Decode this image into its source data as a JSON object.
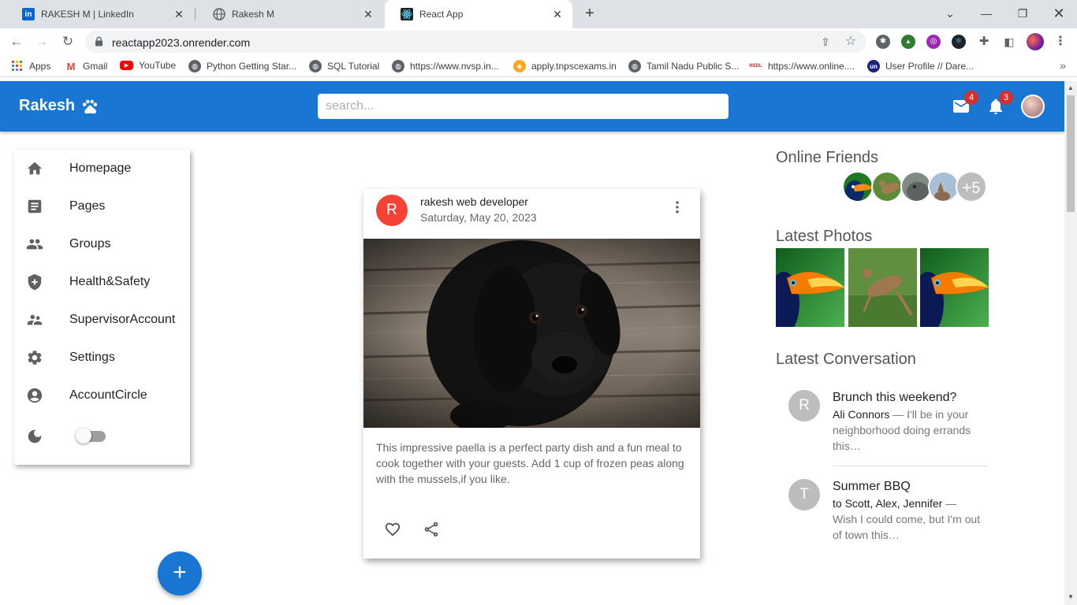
{
  "browser": {
    "tabs": [
      {
        "title": "RAKESH M | LinkedIn",
        "icon": "linkedin-icon",
        "color": "#0a66c2"
      },
      {
        "title": "Rakesh M",
        "icon": "globe-icon",
        "color": "#5f6368"
      },
      {
        "title": "React App",
        "icon": "react-icon",
        "color": "#20232a",
        "active": true
      }
    ],
    "url": "reactapp2023.onrender.com",
    "bookmarks": [
      {
        "label": "Apps",
        "icon": "apps-grid-icon"
      },
      {
        "label": "Gmail",
        "icon": "gmail-icon"
      },
      {
        "label": "YouTube",
        "icon": "youtube-icon"
      },
      {
        "label": "Python Getting Star...",
        "icon": "globe-icon"
      },
      {
        "label": "SQL Tutorial",
        "icon": "globe-icon"
      },
      {
        "label": "https://www.nvsp.in...",
        "icon": "globe-icon"
      },
      {
        "label": "apply.tnpscexams.in",
        "icon": "tn-emblem-icon"
      },
      {
        "label": "Tamil Nadu Public S...",
        "icon": "globe-icon"
      },
      {
        "label": "https://www.online....",
        "icon": "nsdl-icon"
      },
      {
        "label": "User Profile // Dare...",
        "icon": "un-icon"
      }
    ]
  },
  "app": {
    "brand": "Rakesh",
    "search_placeholder": "search...",
    "mail_count": "4",
    "notif_count": "3",
    "accent": "#1976d2"
  },
  "sidebar": {
    "items": [
      {
        "label": "Homepage",
        "icon": "home-icon"
      },
      {
        "label": "Pages",
        "icon": "article-icon"
      },
      {
        "label": "Groups",
        "icon": "groups-icon"
      },
      {
        "label": "Health&Safety",
        "icon": "shield-icon"
      },
      {
        "label": "SupervisorAccount",
        "icon": "supervisor-account-icon"
      },
      {
        "label": "Settings",
        "icon": "gear-icon"
      },
      {
        "label": "AccountCircle",
        "icon": "account-circle-icon"
      }
    ],
    "dark_mode": false
  },
  "post": {
    "avatar_letter": "R",
    "author": "rakesh web developer",
    "date": "Saturday, May 20, 2023",
    "text": "This impressive paella is a perfect party dish and a fun meal to cook together with your guests. Add 1 cup of frozen peas along with the mussels,if you like.",
    "avatar_color": "#f44336"
  },
  "rightbar": {
    "online_title": "Online Friends",
    "online_more": "+5",
    "photos_title": "Latest Photos",
    "conv_title": "Latest Conversation",
    "conversations": [
      {
        "letter": "R",
        "title": "Brunch this weekend?",
        "who": "Ali Connors",
        "text": " — I'll be in your neighborhood doing errands this…"
      },
      {
        "letter": "T",
        "title": "Summer BBQ",
        "who": "to Scott, Alex, Jennifer",
        "text": " — Wish I could come, but I'm out of town this…"
      }
    ]
  }
}
